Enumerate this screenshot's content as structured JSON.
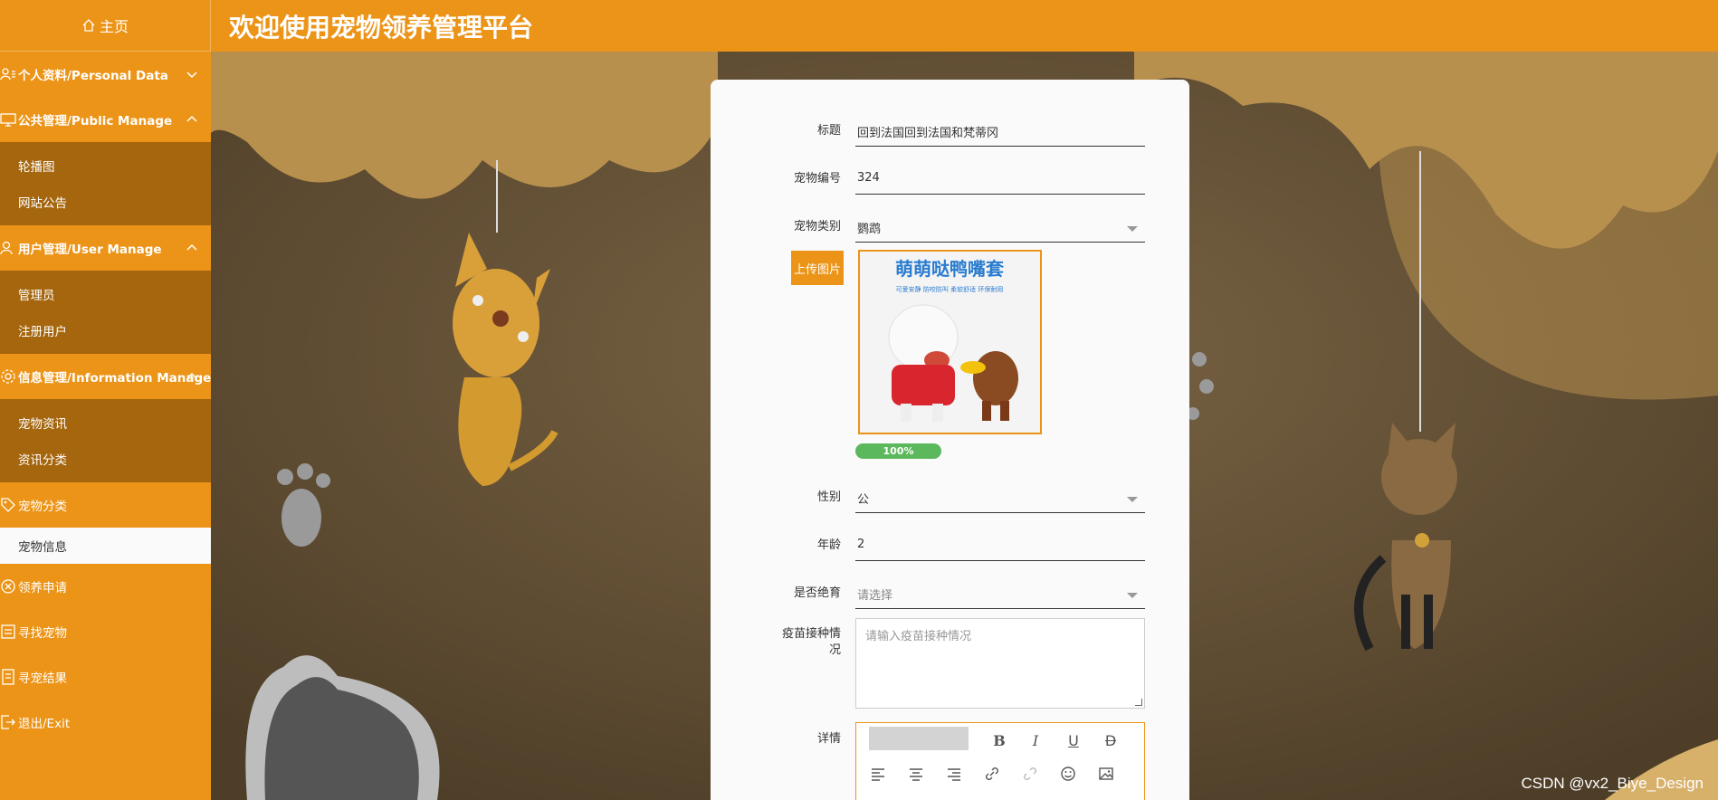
{
  "header": {
    "title": "欢迎使用宠物领养管理平台"
  },
  "sidebar": {
    "home_label": "主页",
    "groups": [
      {
        "label": "个人资料/Personal Data",
        "expanded": false,
        "items": []
      },
      {
        "label": "公共管理/Public Manage",
        "expanded": true,
        "items": [
          "轮播图",
          "网站公告"
        ]
      },
      {
        "label": "用户管理/User Manage",
        "expanded": true,
        "items": [
          "管理员",
          "注册用户"
        ]
      },
      {
        "label": "信息管理/Information Manage",
        "expanded": true,
        "items": [
          "宠物资讯",
          "资讯分类"
        ]
      }
    ],
    "pet_category": "宠物分类",
    "pet_info": "宠物信息",
    "adopt_apply": "领养申请",
    "find_pet": "寻找宠物",
    "find_result": "寻宠结果",
    "logout": "退出/Exit"
  },
  "form": {
    "title_label": "标题",
    "title_value": "回到法国回到法国和梵蒂冈",
    "pet_no_label": "宠物编号",
    "pet_no_value": "324",
    "pet_type_label": "宠物类别",
    "pet_type_value": "鹦鹉",
    "upload_label": "上传图片",
    "upload_progress": "100%",
    "image_caption_title": "萌萌哒鸭嘴套",
    "image_caption_sub": "可爱安静 防咬防叫 柔软舒适 环保耐用",
    "gender_label": "性别",
    "gender_value": "公",
    "age_label": "年龄",
    "age_value": "2",
    "sterilized_label": "是否绝育",
    "sterilized_placeholder": "请选择",
    "vaccine_label": "疫苗接种情况",
    "vaccine_placeholder": "请输入疫苗接种情况",
    "detail_label": "详情"
  },
  "watermark": "CSDN @vx2_Biye_Design",
  "colors": {
    "accent": "#ec9417",
    "submenu": "#a5660e",
    "progress": "#5cb85c"
  }
}
